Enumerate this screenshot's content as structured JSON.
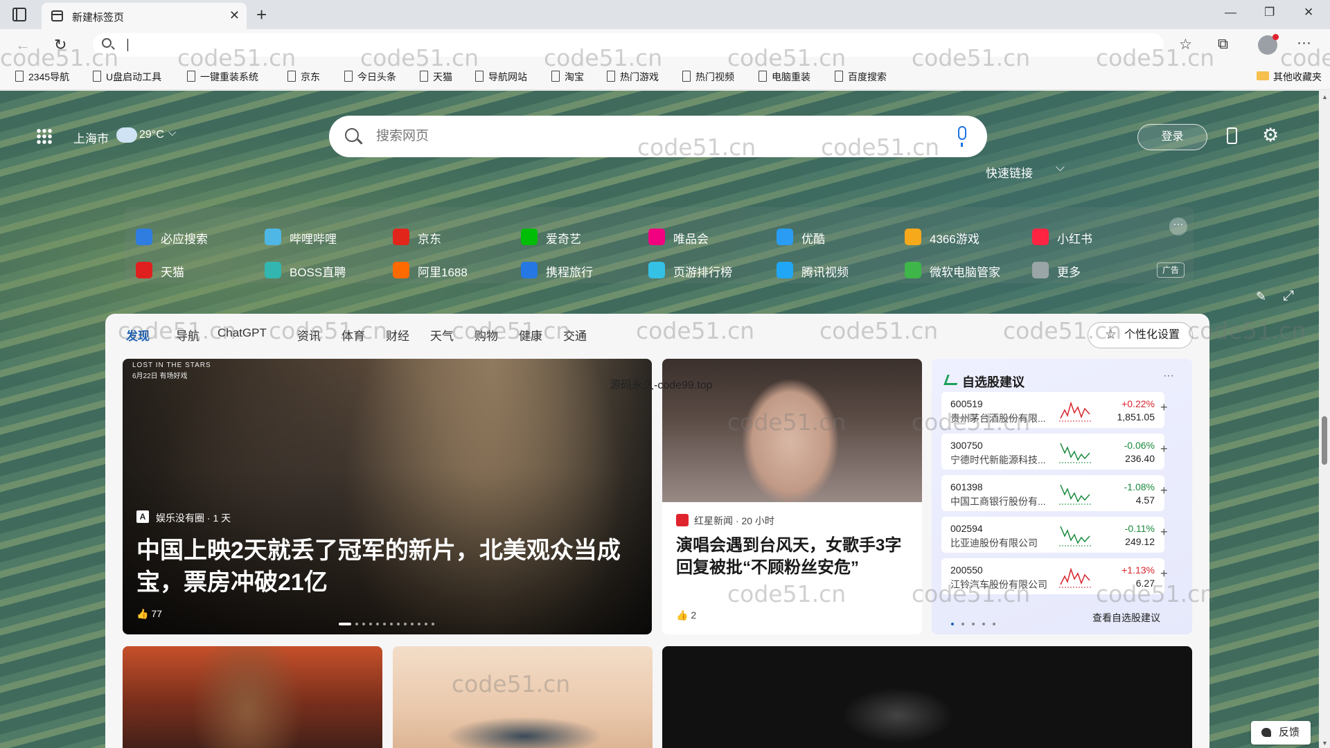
{
  "browser": {
    "tab_title": "新建标签页",
    "new_tab": "+",
    "close_tab": "✕",
    "minimize": "—",
    "restore": "❐",
    "close_window": "✕",
    "back": "←",
    "reload": "↻",
    "star": "☆",
    "collections": "⧉",
    "more": "···"
  },
  "bookmarks": [
    "2345导航",
    "U盘启动工具",
    "一键重装系统",
    "京东",
    "今日头条",
    "天猫",
    "导航网站",
    "淘宝",
    "热门游戏",
    "热门视频",
    "电脑重装",
    "百度搜索"
  ],
  "other_bookmarks": "其他收藏夹",
  "top": {
    "city": "上海市",
    "temp": "29°C",
    "temp_caret": "⌵",
    "search_placeholder": "搜索网页",
    "login": "登录",
    "gear": "⚙",
    "quick_links": "快速链接",
    "ql_caret": "⌵",
    "more_dots": "···",
    "ad": "广告",
    "edit": "✎",
    "expand": "⤢"
  },
  "quicklinks": [
    {
      "label": "必应搜索",
      "color": "#2f7de1"
    },
    {
      "label": "哔哩哔哩",
      "color": "#4eb7e6"
    },
    {
      "label": "京东",
      "color": "#e1251b"
    },
    {
      "label": "爱奇艺",
      "color": "#00be06"
    },
    {
      "label": "唯品会",
      "color": "#f10180"
    },
    {
      "label": "优酷",
      "color": "#2a9cf4"
    },
    {
      "label": "4366游戏",
      "color": "#f6a91b"
    },
    {
      "label": "小红书",
      "color": "#ff2442"
    },
    {
      "label": "天猫",
      "color": "#e01f1f"
    },
    {
      "label": "BOSS直聘",
      "color": "#33b6b0"
    },
    {
      "label": "阿里1688",
      "color": "#ff6a00"
    },
    {
      "label": "携程旅行",
      "color": "#2577e3"
    },
    {
      "label": "页游排行榜",
      "color": "#35c0e6"
    },
    {
      "label": "腾讯视频",
      "color": "#20a6f4"
    },
    {
      "label": "微软电脑管家",
      "color": "#3fb64a"
    },
    {
      "label": "更多",
      "color": "#9aa5a8"
    }
  ],
  "feed": {
    "tabs": [
      "发现",
      "导航",
      "ChatGPT",
      "资讯",
      "体育",
      "财经",
      "天气",
      "购物",
      "健康",
      "交通"
    ],
    "personalize": "个性化设置",
    "hero": {
      "movie_tag": "LOST IN THE STARS",
      "movie_date": "6月22日 有场好戏",
      "source": "娱乐没有圈 · 1 天",
      "title": "中国上映2天就丢了冠军的新片，北美观众当成宝，票房冲破21亿",
      "likes": "👍 77"
    },
    "news2": {
      "source": "红星新闻 · 20 小时",
      "title": "演唱会遇到台风天，女歌手3字回复被批“不顾粉丝安危”",
      "likes": "👍 2"
    },
    "stocks": {
      "title": "自选股建议",
      "menu": "···",
      "more": "查看自选股建议",
      "items": [
        {
          "code": "600519",
          "name": "贵州茅台酒股份有限...",
          "change": "+0.22%",
          "price": "1,851.05",
          "dir": "up"
        },
        {
          "code": "300750",
          "name": "宁德时代新能源科技...",
          "change": "-0.06%",
          "price": "236.40",
          "dir": "down"
        },
        {
          "code": "601398",
          "name": "中国工商银行股份有...",
          "change": "-1.08%",
          "price": "4.57",
          "dir": "down"
        },
        {
          "code": "002594",
          "name": "比亚迪股份有限公司",
          "change": "-0.11%",
          "price": "249.12",
          "dir": "down"
        },
        {
          "code": "200550",
          "name": "江铃汽车股份有限公司",
          "change": "+1.13%",
          "price": "6.27",
          "dir": "up"
        }
      ],
      "add": "+"
    }
  },
  "feedback": "反馈",
  "watermark": "code51.cn",
  "watermark_note": "源码永久-code99.top"
}
